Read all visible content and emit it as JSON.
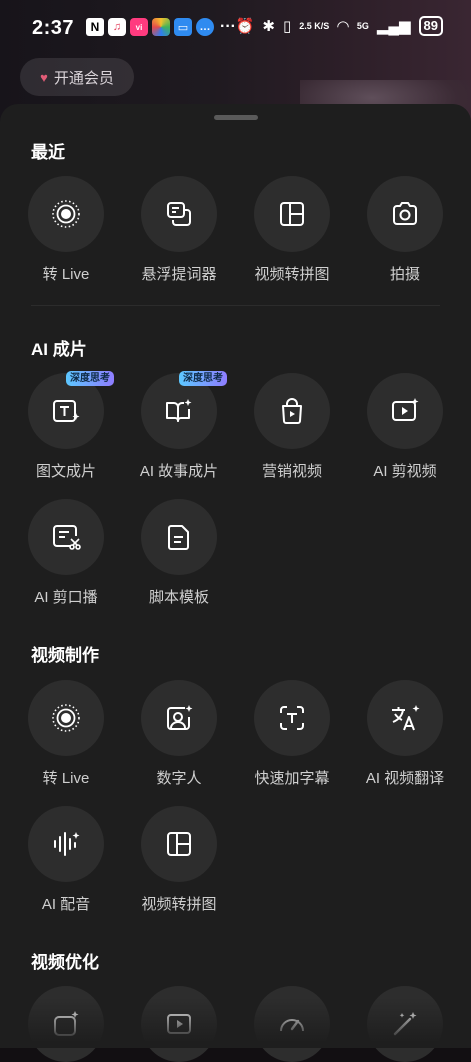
{
  "status": {
    "time": "2:37",
    "network_speed": "2.5 K/S",
    "network_type": "5G",
    "battery": "89"
  },
  "vip_button": {
    "label": "开通会员"
  },
  "sections": {
    "recent": {
      "title": "最近",
      "items": [
        {
          "label": "转 Live",
          "icon": "live-icon"
        },
        {
          "label": "悬浮提词器",
          "icon": "floating-teleprompter-icon"
        },
        {
          "label": "视频转拼图",
          "icon": "collage-icon"
        },
        {
          "label": "拍摄",
          "icon": "camera-icon"
        }
      ]
    },
    "ai_film": {
      "title": "AI 成片",
      "items": [
        {
          "label": "图文成片",
          "icon": "text-sparkle-icon",
          "badge": "深度思考"
        },
        {
          "label": "AI 故事成片",
          "icon": "book-sparkle-icon",
          "badge": "深度思考"
        },
        {
          "label": "营销视频",
          "icon": "shopping-bag-icon"
        },
        {
          "label": "AI 剪视频",
          "icon": "video-play-sparkle-icon"
        },
        {
          "label": "AI 剪口播",
          "icon": "script-cut-icon"
        },
        {
          "label": "脚本模板",
          "icon": "document-icon"
        }
      ]
    },
    "video_make": {
      "title": "视频制作",
      "items": [
        {
          "label": "转 Live",
          "icon": "live-icon"
        },
        {
          "label": "数字人",
          "icon": "digital-human-icon"
        },
        {
          "label": "快速加字幕",
          "icon": "subtitle-icon"
        },
        {
          "label": "AI 视频翻译",
          "icon": "translate-icon"
        },
        {
          "label": "AI 配音",
          "icon": "voice-wave-icon"
        },
        {
          "label": "视频转拼图",
          "icon": "collage-icon"
        }
      ]
    },
    "video_optimize": {
      "title": "视频优化",
      "items": [
        {
          "icon": "enhance-icon"
        },
        {
          "icon": "video-play-icon"
        },
        {
          "icon": "speedometer-icon"
        },
        {
          "icon": "magic-wand-icon"
        }
      ]
    }
  }
}
